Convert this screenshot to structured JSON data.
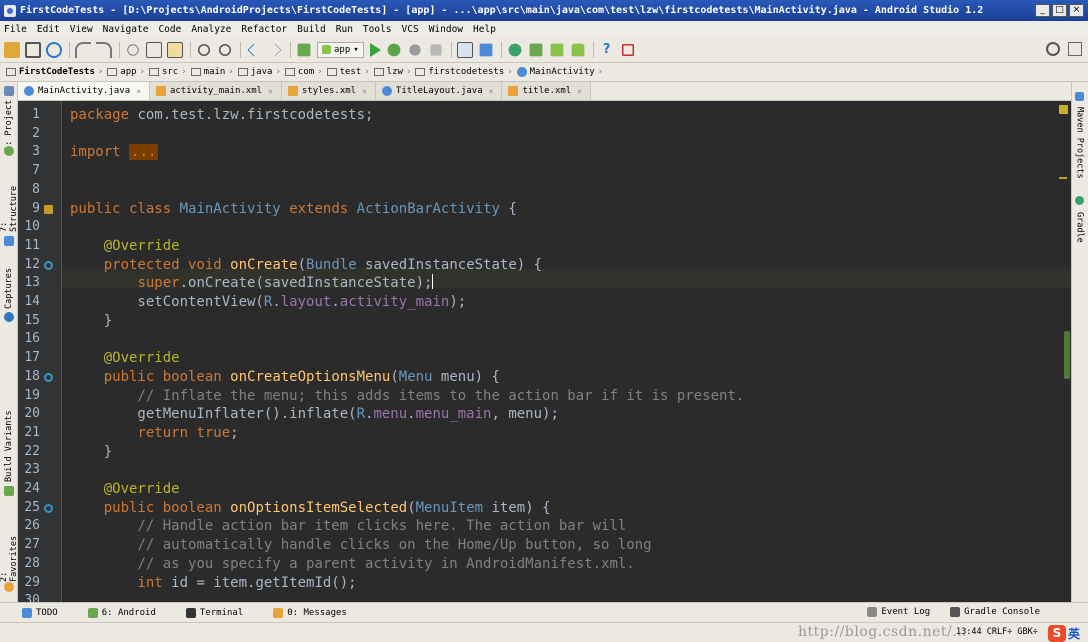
{
  "window": {
    "title": "FirstCodeTests - [D:\\Projects\\AndroidProjects\\FirstCodeTests] - [app] - ...\\app\\src\\main\\java\\com\\test\\lzw\\firstcodetests\\MainActivity.java - Android Studio 1.2",
    "minimize": "_",
    "maximize": "□",
    "close": "×"
  },
  "menu": [
    "File",
    "Edit",
    "View",
    "Navigate",
    "Code",
    "Analyze",
    "Refactor",
    "Build",
    "Run",
    "Tools",
    "VCS",
    "Window",
    "Help"
  ],
  "toolbar": {
    "run_config": "app"
  },
  "breadcrumb": [
    "FirstCodeTests",
    "app",
    "src",
    "main",
    "java",
    "com",
    "test",
    "lzw",
    "firstcodetests",
    "MainActivity"
  ],
  "tabs": [
    {
      "label": "MainActivity.java",
      "type": "java",
      "active": true
    },
    {
      "label": "activity_main.xml",
      "type": "xml",
      "active": false
    },
    {
      "label": "styles.xml",
      "type": "xml",
      "active": false
    },
    {
      "label": "TitleLayout.java",
      "type": "java",
      "active": false
    },
    {
      "label": "title.xml",
      "type": "xml",
      "active": false
    }
  ],
  "left_tools": [
    "1: Project",
    "7: Structure",
    "Captures",
    "Build Variants",
    "2: Favorites"
  ],
  "right_tools": [
    "Maven Projects",
    "Gradle"
  ],
  "editor": {
    "lines": [
      {
        "n": "1",
        "html": "<span class=\"kw\">package</span> com.test.lzw.firstcodetests;"
      },
      {
        "n": "2",
        "html": ""
      },
      {
        "n": "3",
        "html": "<span class=\"kw\">import</span> <span class=\"fold\">...</span>"
      },
      {
        "n": "7",
        "html": ""
      },
      {
        "n": "8",
        "html": ""
      },
      {
        "n": "9",
        "html": "<span class=\"kw\">public class</span> <span class=\"cls\">MainActivity</span> <span class=\"kw\">extends</span> <span class=\"cls\">ActionBarActivity</span> {",
        "mark": "run"
      },
      {
        "n": "10",
        "html": ""
      },
      {
        "n": "11",
        "html": "    <span class=\"ann\">@Override</span>"
      },
      {
        "n": "12",
        "html": "    <span class=\"kw\">protected void</span> <span class=\"fn\">onCreate</span>(<span class=\"cls\">Bundle</span> savedInstanceState) {",
        "mark": "override"
      },
      {
        "n": "13",
        "html": "        <span class=\"kw\">super</span>.onCreate(savedInstanceState);<span class=\"caret\"></span>"
      },
      {
        "n": "14",
        "html": "        setContentView(<span class=\"cls\">R</span>.<span class=\"fld\">layout</span>.<span class=\"fld\">activity_main</span>);"
      },
      {
        "n": "15",
        "html": "    }"
      },
      {
        "n": "16",
        "html": ""
      },
      {
        "n": "17",
        "html": "    <span class=\"ann\">@Override</span>"
      },
      {
        "n": "18",
        "html": "    <span class=\"kw\">public boolean</span> <span class=\"fn\">onCreateOptionsMenu</span>(<span class=\"cls\">Menu</span> menu) {",
        "mark": "override"
      },
      {
        "n": "19",
        "html": "        <span class=\"cm\">// Inflate the menu; this adds items to the action bar if it is present.</span>"
      },
      {
        "n": "20",
        "html": "        getMenuInflater().inflate(<span class=\"cls\">R</span>.<span class=\"fld\">menu</span>.<span class=\"fld\">menu_main</span>, menu);"
      },
      {
        "n": "21",
        "html": "        <span class=\"kw\">return true</span>;"
      },
      {
        "n": "22",
        "html": "    }"
      },
      {
        "n": "23",
        "html": ""
      },
      {
        "n": "24",
        "html": "    <span class=\"ann\">@Override</span>"
      },
      {
        "n": "25",
        "html": "    <span class=\"kw\">public boolean</span> <span class=\"fn\">onOptionsItemSelected</span>(<span class=\"cls\">MenuItem</span> item) {",
        "mark": "override"
      },
      {
        "n": "26",
        "html": "        <span class=\"cm\">// Handle action bar item clicks here. The action bar will</span>"
      },
      {
        "n": "27",
        "html": "        <span class=\"cm\">// automatically handle clicks on the Home/Up button, so long</span>"
      },
      {
        "n": "28",
        "html": "        <span class=\"cm\">// as you specify a parent activity in AndroidManifest.xml.</span>"
      },
      {
        "n": "29",
        "html": "        <span class=\"kw\">int</span> id = item.getItemId();"
      },
      {
        "n": "30",
        "html": ""
      }
    ]
  },
  "bottom_tools_left": [
    "TODO",
    "6: Android",
    "Terminal",
    "0: Messages"
  ],
  "bottom_tools_right": [
    "Event Log",
    "Gradle Console"
  ],
  "status": {
    "position": "13:44  CRLF÷ GBK÷",
    "watermark": "http://blog.csdn.net/...",
    "ime_logo": "S",
    "ime_lang": "英"
  }
}
